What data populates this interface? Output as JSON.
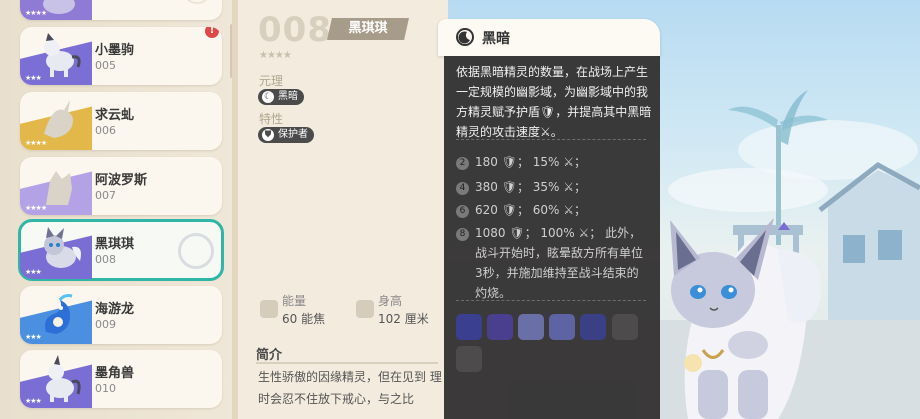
{
  "list": {
    "items": [
      {
        "name": "",
        "number": "",
        "stars": "★★★★",
        "color": "#8f7ad6",
        "dim": false
      },
      {
        "name": "小墨驹",
        "number": "005",
        "stars": "★★★",
        "color": "#7b6fd6",
        "dim": false,
        "alert": "!"
      },
      {
        "name": "求云虬",
        "number": "006",
        "stars": "★★★★",
        "color": "#e3b84a",
        "dim": true
      },
      {
        "name": "阿波罗斯",
        "number": "007",
        "stars": "★★★★",
        "color": "#b3a3e6",
        "dim": true
      },
      {
        "name": "黑琪琪",
        "number": "008",
        "stars": "★★★",
        "color": "#7a6ed4",
        "dim": false,
        "selected": true
      },
      {
        "name": "海游龙",
        "number": "009",
        "stars": "★★★",
        "color": "#4a8fe0",
        "dim": false
      },
      {
        "name": "墨角兽",
        "number": "010",
        "stars": "★★★",
        "color": "#7a6ed4",
        "dim": false
      }
    ]
  },
  "detail": {
    "number": "008",
    "name": "黑琪琪",
    "rarity": "★★★★",
    "element_label": "元理",
    "element_value": "黑暗",
    "trait_label": "特性",
    "trait_value": "保护者",
    "energy_label": "能量",
    "energy_value": "60 能焦",
    "height_label": "身高",
    "height_value": "102 厘米",
    "intro_title": "简介",
    "intro_text": "生性骄傲的因缘精灵，但在见到 理时会忍不住放下戒心，与之比"
  },
  "tooltip": {
    "title": "黑暗",
    "description": "依据黑暗精灵的数量，在战场上产生一定规模的幽影域，为幽影域中的我方精灵赋予护盾🛡，并提高其中黑暗精灵的攻击速度⚔。",
    "levels": [
      {
        "n": "2",
        "text": "180 🛡； 15% ⚔；"
      },
      {
        "n": "4",
        "text": "380 🛡； 35% ⚔；"
      },
      {
        "n": "6",
        "text": "620 🛡； 60% ⚔；"
      },
      {
        "n": "8",
        "text": "1080 🛡； 100% ⚔； 此外，战斗开始时，眩晕敌方所有单位3秒，并施加维持至战斗结束的灼烧。"
      }
    ]
  },
  "colors": {
    "accent": "#2fb6a6",
    "tooltip_bg": "#343232",
    "panel_bg": "#f2ebde"
  }
}
